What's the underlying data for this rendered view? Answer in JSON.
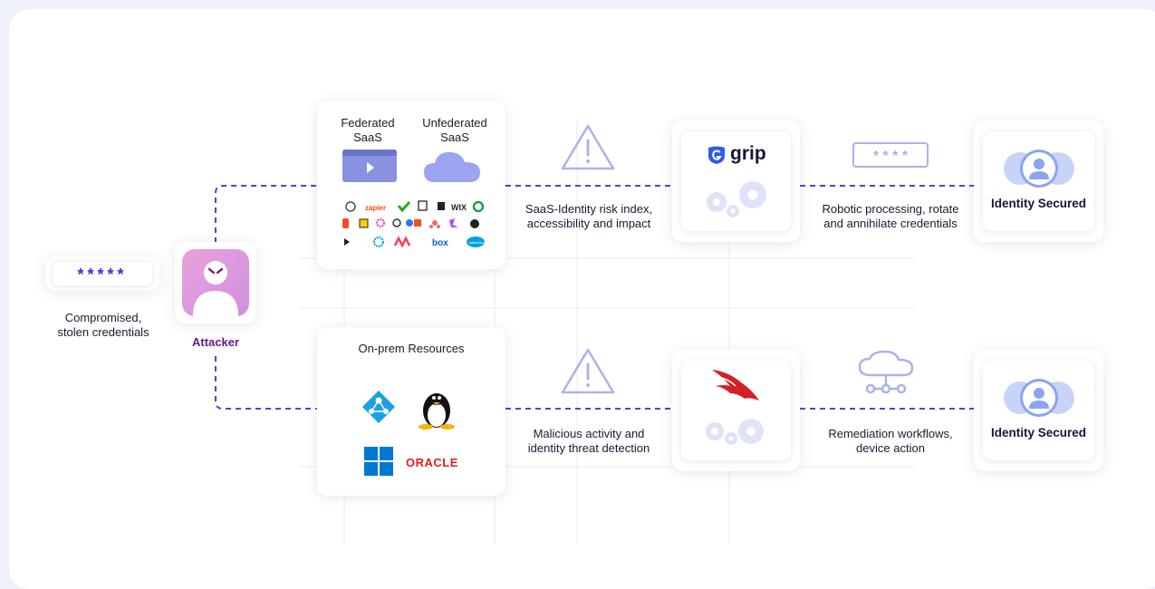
{
  "credentials": {
    "mask": "*****",
    "label_line1": "Compromised,",
    "label_line2": "stolen credentials"
  },
  "attacker": {
    "label": "Attacker"
  },
  "saas_card": {
    "federated_line1": "Federated",
    "federated_line2": "SaaS",
    "unfederated_line1": "Unfederated",
    "unfederated_line2": "SaaS",
    "app_logos": [
      "zapier",
      "wix",
      "box",
      "salesforce",
      "notion",
      "monday",
      "asana",
      "figma",
      "qlik",
      "mailchimp"
    ]
  },
  "onprem_card": {
    "title": "On-prem Resources",
    "logos": [
      "azure-ad",
      "linux",
      "windows",
      "oracle"
    ],
    "oracle_text": "ORACLE"
  },
  "top_flow": {
    "risk_line1": "SaaS-Identity risk index,",
    "risk_line2": "accessibility and impact",
    "grip_name": "grip",
    "action_line1": "Robotic processing, rotate",
    "action_line2": "and annihilate credentials",
    "password_mask": "* * * *",
    "result": "Identity Secured"
  },
  "bottom_flow": {
    "threat_line1": "Malicious activity and",
    "threat_line2": "identity threat detection",
    "action_line1": "Remediation workflows,",
    "action_line2": "device action",
    "result": "Identity Secured"
  },
  "colors": {
    "accent": "#5b3fd4",
    "attacker": "#6a1a86",
    "icon": "#aab3ea",
    "gear": "#dfe3f8",
    "crowdstrike": "#d4202a"
  }
}
